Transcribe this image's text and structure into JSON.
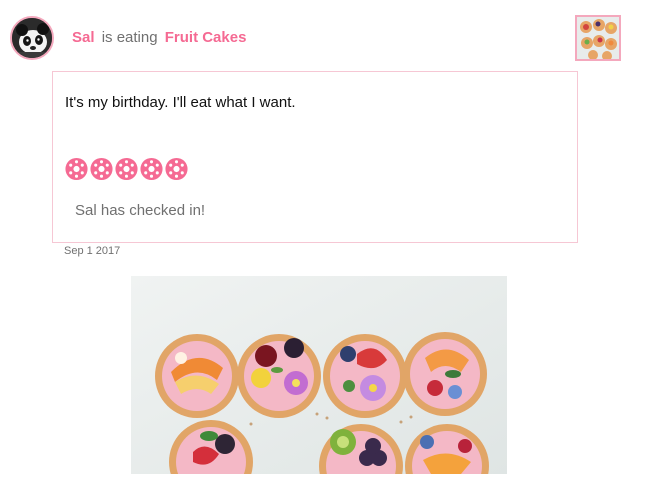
{
  "post": {
    "user_name": "Sal",
    "action_text": "is eating",
    "item_name": "Fruit Cakes",
    "message": "It's my birthday. I'll eat what I want.",
    "rating": 5,
    "rating_max": 5,
    "checkin_text": "Sal has checked in!",
    "date": "Sep 1 2017"
  },
  "icons": {
    "avatar": "panda-avatar",
    "thumbnail": "fruit-cakes-thumbnail",
    "rating": "donut-icon",
    "photo": "fruit-cakes-photo"
  },
  "colors": {
    "accent": "#f56a93",
    "border": "#f6c7d4",
    "muted_text": "#707070",
    "donut_dots": "#ffffff"
  }
}
